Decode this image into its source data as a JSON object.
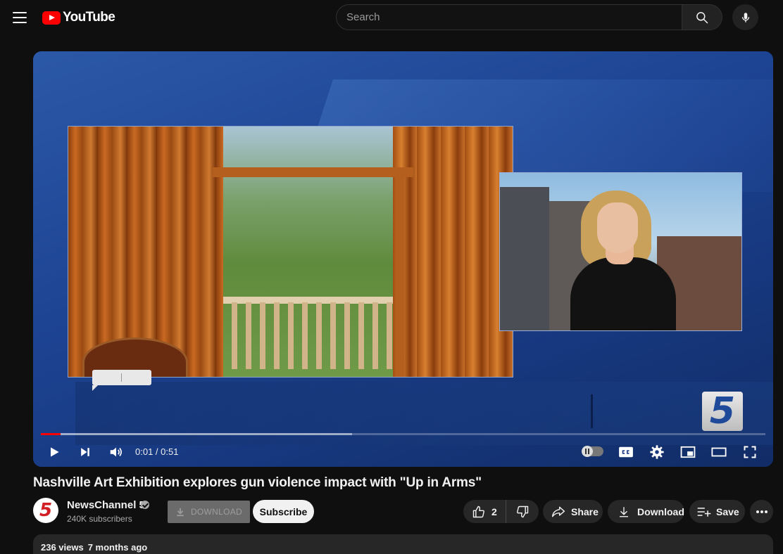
{
  "masthead": {
    "logo_text": "YouTube",
    "search_placeholder": "Search"
  },
  "player": {
    "current_time": "0:01",
    "duration": "0:51",
    "time_separator": " / ",
    "progress_played_fraction": 0.027,
    "progress_loaded_fraction": 0.43,
    "station_logo": "5"
  },
  "video": {
    "title": "Nashville Art Exhibition explores gun violence impact with \"Up in Arms\""
  },
  "channel": {
    "avatar_text": "5",
    "name": "NewsChannel 5",
    "subscribers": "240K subscribers"
  },
  "actions": {
    "download_ext_label": "DOWNLOAD",
    "subscribe_label": "Subscribe",
    "like_count": "2",
    "share_label": "Share",
    "download_label": "Download",
    "save_label": "Save"
  },
  "description": {
    "views": "236 views",
    "age": "7 months ago"
  },
  "colors": {
    "background": "#0f0f0f",
    "accent": "#ff0000",
    "pill": "#272727",
    "subscribe_bg": "#f1f1f1"
  }
}
